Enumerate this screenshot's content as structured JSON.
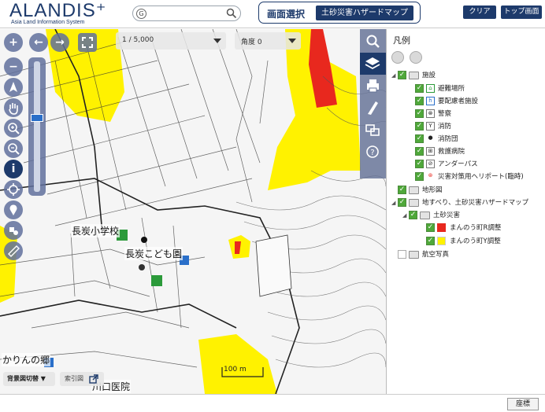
{
  "header": {
    "logo_title": "ALANDIS⁺",
    "logo_subtitle": "Asia Land Information System",
    "search": {
      "prefix": "G",
      "value": "",
      "placeholder": ""
    },
    "screen_select_label": "画面選択",
    "screen_select_value": "土砂災害ハザードマップ",
    "clear_label": "クリア",
    "top_label": "トップ画面へ"
  },
  "map": {
    "scale_label": "1 / 5,000",
    "angle_label": "角度  0",
    "labels": {
      "school": "長炭小学校",
      "kindergarten": "長炭こども園",
      "karin": "かりんの郷",
      "clinic": "川口医院"
    },
    "scalebar_label": "100 m",
    "bg_switch_label": "背景図切替",
    "index_label": "索引図"
  },
  "legend": {
    "title": "凡例",
    "rows": [
      {
        "label": "施設"
      },
      {
        "label": "避難場所"
      },
      {
        "label": "要配慮者施設"
      },
      {
        "label": "警察"
      },
      {
        "label": "消防"
      },
      {
        "label": "消防団"
      },
      {
        "label": "救護病院"
      },
      {
        "label": "アンダーパス"
      },
      {
        "label": "災害対策用ヘリポート(臨時)"
      },
      {
        "label": "地形図"
      },
      {
        "label": "地すべり、土砂災害ハザードマップ"
      },
      {
        "label": "土砂災害"
      },
      {
        "label": "まんのう町R調整"
      },
      {
        "label": "まんのう町Y調整"
      },
      {
        "label": "航空写真"
      }
    ]
  },
  "footer": {
    "coord_label": "座標"
  },
  "colors": {
    "accent": "#1d3a6b",
    "hazard_red": "#e8281e",
    "hazard_yellow": "#fff200",
    "check_green": "#4fa83a"
  }
}
